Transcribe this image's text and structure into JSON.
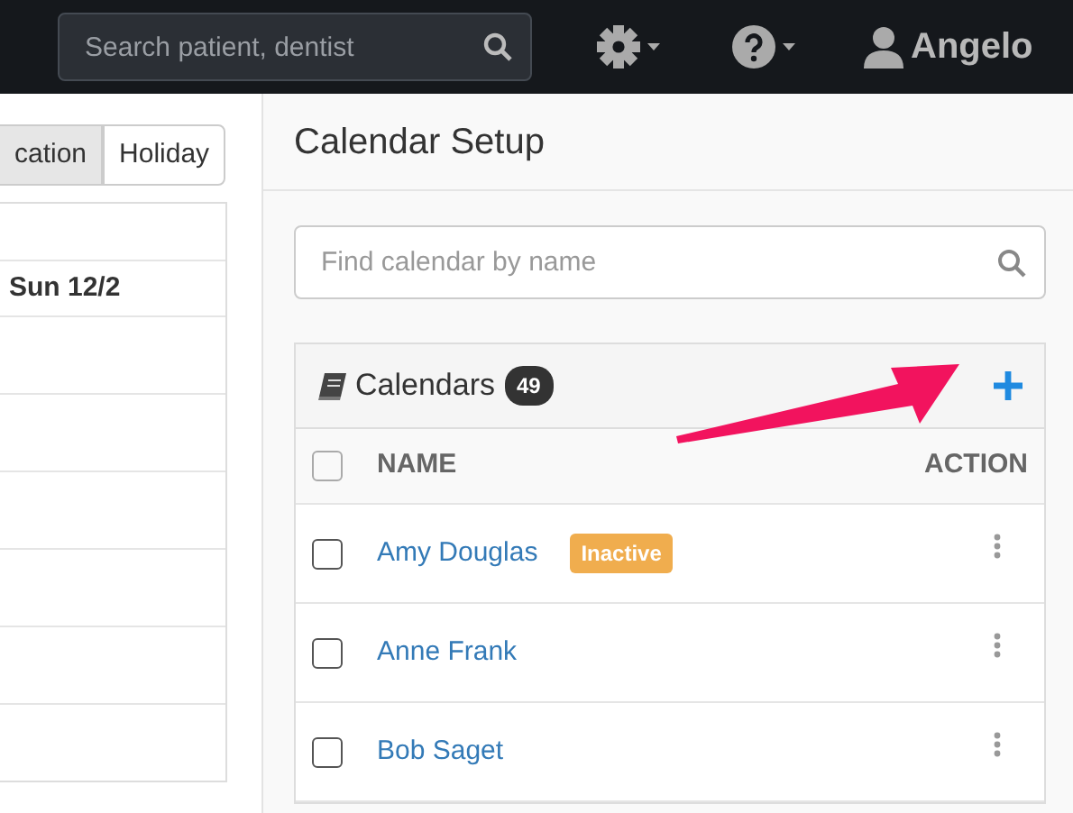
{
  "navbar": {
    "search": {
      "placeholder": "Search patient, dentist"
    },
    "user": "Angelo"
  },
  "calendar_view": {
    "tabs": [
      {
        "label": "cation",
        "selected": true
      },
      {
        "label": "Holiday",
        "selected": false
      }
    ],
    "day_header": "Sun 12/2"
  },
  "setup": {
    "title": "Calendar Setup",
    "search": {
      "placeholder": "Find calendar by name"
    },
    "calendars": {
      "title": "Calendars",
      "count": "49",
      "columns": [
        "NAME",
        "ACTION"
      ],
      "select_all": {
        "checked": false
      },
      "rows": [
        {
          "name": "Amy Douglas",
          "badge": "Inactive",
          "checked": false
        },
        {
          "name": "Anne Frank",
          "checked": false
        },
        {
          "name": "Bob Saget",
          "checked": false
        }
      ]
    }
  }
}
